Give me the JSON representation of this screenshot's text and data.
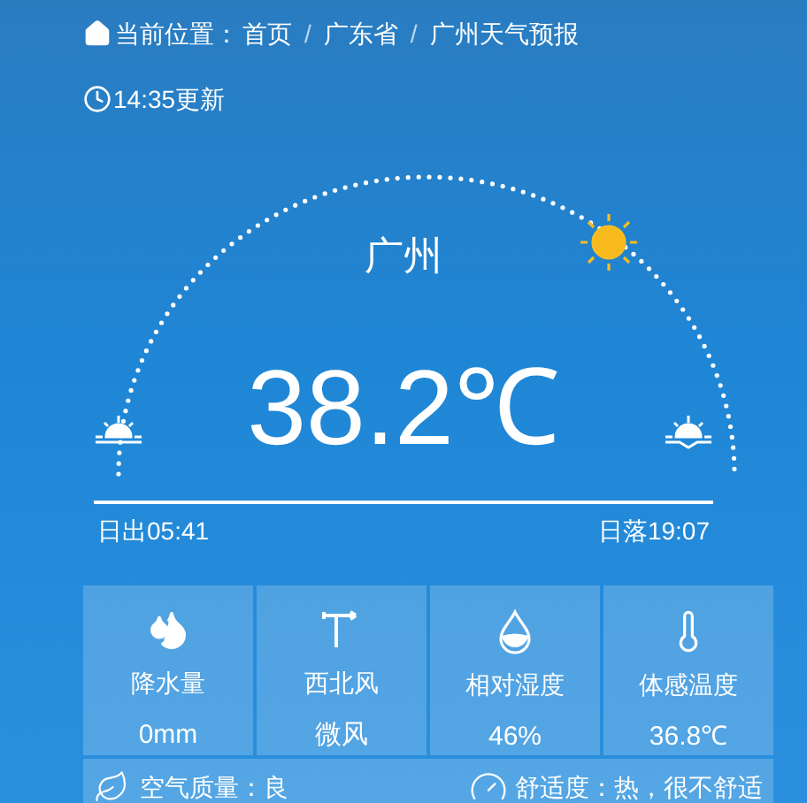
{
  "breadcrumb": {
    "label": "当前位置：",
    "separator": "/",
    "items": [
      "首页",
      "广东省",
      "广州天气预报"
    ]
  },
  "updated": "14:35更新",
  "city": "广州",
  "temperature": "38.2℃",
  "sunrise": "日出05:41",
  "sunset": "日落19:07",
  "stats": [
    {
      "kind": "rain",
      "label": "降水量",
      "value": "0mm"
    },
    {
      "kind": "wind",
      "label": "西北风",
      "value": "微风"
    },
    {
      "kind": "humidity",
      "label": "相对湿度",
      "value": "46%"
    },
    {
      "kind": "feels",
      "label": "体感温度",
      "value": "36.8℃"
    }
  ],
  "air_quality": "空气质量：良",
  "comfort": "舒适度：热，很不舒适"
}
